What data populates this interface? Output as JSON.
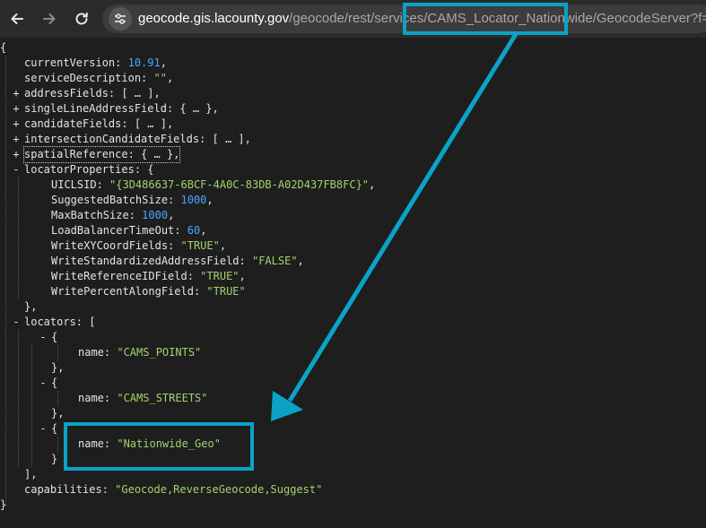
{
  "browser": {
    "url_host": "geocode.gis.lacounty.gov",
    "url_path_before": "/geocode/rest/services/",
    "url_path_highlight": "CAMS_Locator_Nationwide",
    "url_path_after": "/GeocodeServer?f=json",
    "icons": [
      "back-arrow-icon",
      "forward-arrow-icon",
      "reload-icon",
      "site-settings-icon"
    ]
  },
  "json": {
    "open_brace": "{",
    "close_brace": "}",
    "current_version_key": "currentVersion",
    "current_version_value": "10.91",
    "service_description_key": "serviceDescription",
    "service_description_value": "\"\"",
    "collapsed": [
      {
        "key": "addressFields",
        "preview": "[ … ],"
      },
      {
        "key": "singleLineAddressField",
        "preview": "{ … },"
      },
      {
        "key": "candidateFields",
        "preview": "[ … ],"
      },
      {
        "key": "intersectionCandidateFields",
        "preview": "[ … ],"
      },
      {
        "key": "spatialReference",
        "preview": "{ … },"
      }
    ],
    "locator_properties_key": "locatorProperties",
    "locator_properties": [
      {
        "key": "UICLSID",
        "value": "\"{3D486637-6BCF-4A0C-83DB-A02D437FB8FC}\"",
        "type": "str"
      },
      {
        "key": "SuggestedBatchSize",
        "value": "1000",
        "type": "num"
      },
      {
        "key": "MaxBatchSize",
        "value": "1000",
        "type": "num"
      },
      {
        "key": "LoadBalancerTimeOut",
        "value": "60",
        "type": "num"
      },
      {
        "key": "WriteXYCoordFields",
        "value": "\"TRUE\"",
        "type": "str"
      },
      {
        "key": "WriteStandardizedAddressField",
        "value": "\"FALSE\"",
        "type": "str"
      },
      {
        "key": "WriteReferenceIDField",
        "value": "\"TRUE\"",
        "type": "str"
      },
      {
        "key": "WritePercentAlongField",
        "value": "\"TRUE\"",
        "type": "str"
      }
    ],
    "locators_key": "locators",
    "locator_name_key": "name",
    "locators": [
      {
        "name": "\"CAMS_POINTS\""
      },
      {
        "name": "\"CAMS_STREETS\""
      },
      {
        "name": "\"Nationwide_Geo\""
      }
    ],
    "capabilities_key": "capabilities",
    "capabilities_value": "\"Geocode,ReverseGeocode,Suggest\""
  },
  "annotation": {
    "color": "#0aa3c6"
  }
}
